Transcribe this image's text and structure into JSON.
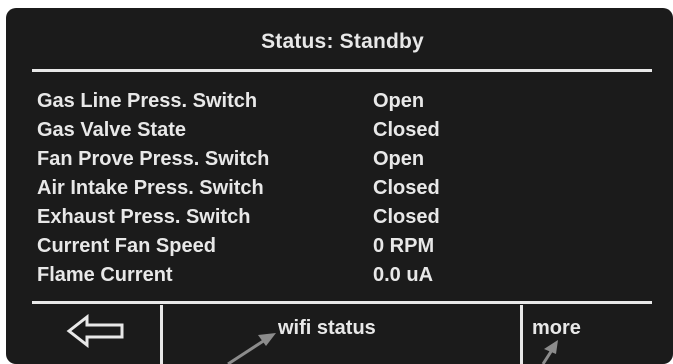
{
  "header": {
    "title": "Status: Standby"
  },
  "status_rows": [
    {
      "label": "Gas Line Press. Switch",
      "value": "Open"
    },
    {
      "label": "Gas Valve State",
      "value": "Closed"
    },
    {
      "label": "Fan Prove Press. Switch",
      "value": "Open"
    },
    {
      "label": "Air Intake Press. Switch",
      "value": "Closed"
    },
    {
      "label": "Exhaust Press. Switch",
      "value": "Closed"
    },
    {
      "label": "Current Fan Speed",
      "value": "0 RPM"
    },
    {
      "label": "Flame Current",
      "value": "0.0 uA"
    }
  ],
  "footer": {
    "back_icon": "left-arrow-icon",
    "wifi_label": "wifi status",
    "more_label": "more"
  },
  "colors": {
    "screen_background": "#1b1b1b",
    "text": "#e8e8e8",
    "annotation_arrow": "#8c8c8c"
  }
}
